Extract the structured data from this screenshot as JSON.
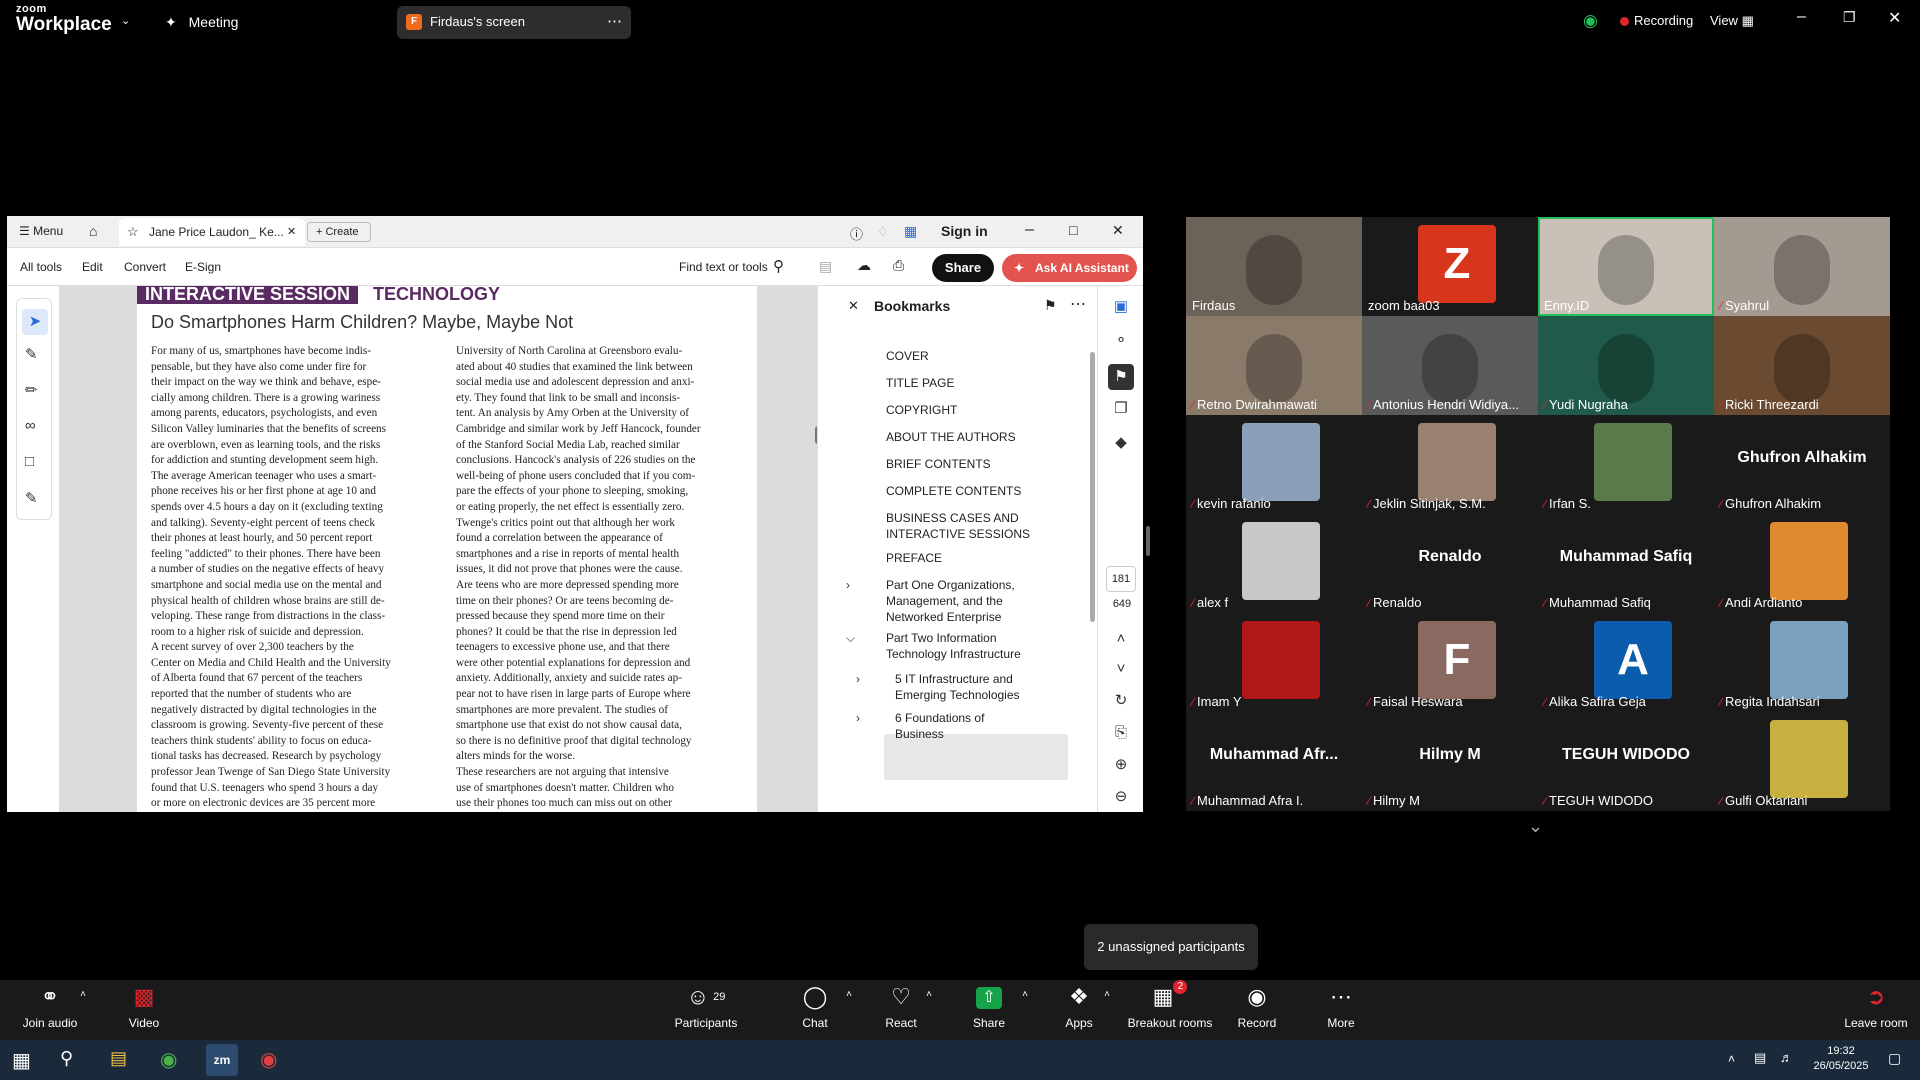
{
  "zoom": {
    "brand_small": "zoom",
    "brand_big": "Workplace",
    "meeting_label": "Meeting",
    "share_pill_label": "Firdaus's screen",
    "share_pill_initial": "F",
    "recording_label": "Recording",
    "view_label": "View"
  },
  "pdf": {
    "menu_label": "Menu",
    "tab_label": "Jane Price Laudon_ Ke...",
    "create_label": "Create",
    "sign_in_label": "Sign in",
    "tools": [
      "All tools",
      "Edit",
      "Convert",
      "E-Sign"
    ],
    "find_label": "Find text or tools",
    "share_label": "Share",
    "ai_label": "Ask AI Assistant",
    "session_label": "INTERACTIVE SESSION",
    "session_topic": "TECHNOLOGY",
    "article_title": "Do Smartphones Harm Children? Maybe, Maybe Not",
    "col1": [
      "For many of us, smartphones have become indis-",
      "pensable, but they have also come under fire for",
      "their impact on the way we think and behave, espe-",
      "cially among children. There is a growing wariness",
      "among parents, educators, psychologists, and even",
      "Silicon Valley luminaries that the benefits of screens",
      "are overblown, even as learning tools, and the risks",
      "for addiction and stunting development seem high.",
      "   The average American teenager who uses a smart-",
      "phone receives his or her first phone at age 10 and",
      "spends over 4.5 hours a day on it (excluding texting",
      "and talking). Seventy-eight percent of teens check",
      "their phones at least hourly, and 50 percent report",
      "feeling \"addicted\" to their phones. There have been",
      "a number of studies on the negative effects of heavy",
      "smartphone and social media use on the mental and",
      "physical health of children whose brains are still de-",
      "veloping. These range from distractions in the class-",
      "room to a higher risk of suicide and depression.",
      "   A recent survey of over 2,300 teachers by the",
      "Center on Media and Child Health and the University",
      "of Alberta found that 67 percent of the teachers",
      "reported that the number of students who are",
      "negatively distracted by digital technologies in the",
      "classroom is growing. Seventy-five percent of these",
      "teachers think students' ability to focus on educa-",
      "tional tasks has decreased. Research by psychology",
      "professor Jean Twenge of San Diego State University",
      "found that U.S. teenagers who spend 3 hours a day",
      "or more on electronic devices are 35 percent more"
    ],
    "col2": [
      "University of North Carolina at Greensboro evalu-",
      "ated about 40 studies that examined the link between",
      "social media use and adolescent depression and anxi-",
      "ety. They found that link to be small and inconsis-",
      "tent. An analysis by Amy Orben at the University of",
      "Cambridge and similar work by Jeff Hancock, founder",
      "of the Stanford Social Media Lab, reached similar",
      "conclusions. Hancock's analysis of 226 studies on the",
      "well-being of phone users concluded that if you com-",
      "pare the effects of your phone to sleeping, smoking,",
      "or eating properly, the net effect is essentially zero.",
      "   Twenge's critics point out that although her work",
      "found a correlation between the appearance of",
      "smartphones and a rise in reports of mental health",
      "issues, it did not prove that phones were the cause.",
      "Are teens who are more depressed spending more",
      "time on their phones? Or are teens becoming de-",
      "pressed because they spend more time on their",
      "phones? It could be that the rise in depression led",
      "teenagers to excessive phone use, and that there",
      "were other potential explanations for depression and",
      "anxiety. Additionally, anxiety and suicide rates ap-",
      "pear not to have risen in large parts of Europe where",
      "smartphones are more prevalent. The studies of",
      "smartphone use that exist do not show causal data,",
      "so there is no definitive proof that digital technology",
      "alters minds for the worse.",
      "   These researchers are not arguing that intensive",
      "use of smartphones doesn't matter. Children who",
      "use their phones too much can miss out on other"
    ],
    "bookmarks_title": "Bookmarks",
    "bookmarks": [
      {
        "label": "COVER",
        "expand": ""
      },
      {
        "label": "TITLE PAGE",
        "expand": ""
      },
      {
        "label": "COPYRIGHT",
        "expand": ""
      },
      {
        "label": "ABOUT THE AUTHORS",
        "expand": ""
      },
      {
        "label": "BRIEF CONTENTS",
        "expand": ""
      },
      {
        "label": "COMPLETE CONTENTS",
        "expand": ""
      },
      {
        "label": "BUSINESS CASES AND INTERACTIVE SESSIONS",
        "expand": ""
      },
      {
        "label": "PREFACE",
        "expand": ""
      },
      {
        "label": "Part One Organizations, Management, and the Networked Enterprise",
        "expand": ">"
      },
      {
        "label": "Part Two Information Technology Infrastructure",
        "expand": "v"
      },
      {
        "label": "5 IT Infrastructure and Emerging Technologies",
        "expand": ">"
      },
      {
        "label": "6 Foundations of Business",
        "expand": ">"
      }
    ],
    "page_current": "181",
    "page_total": "649"
  },
  "participants": [
    {
      "name": "Firdaus",
      "muted": false,
      "kind": "video",
      "color": "#6b6258"
    },
    {
      "name": "zoom baa03",
      "muted": false,
      "kind": "letter",
      "letter": "Z",
      "color": "#d8351d"
    },
    {
      "name": "Enny.ID",
      "muted": false,
      "kind": "video",
      "color": "#c9c1b8",
      "active": true
    },
    {
      "name": "Syahrul",
      "muted": true,
      "kind": "video",
      "color": "#a39a92"
    },
    {
      "name": "Retno Dwirahmawati",
      "muted": true,
      "kind": "video",
      "color": "#8a7a6a"
    },
    {
      "name": "Antonius Hendri Widiya...",
      "muted": true,
      "kind": "video",
      "color": "#5a5a5a"
    },
    {
      "name": "Yudi Nugraha",
      "muted": true,
      "kind": "video",
      "color": "#1f5a4a"
    },
    {
      "name": "Ricki Threezardi",
      "muted": true,
      "kind": "video",
      "color": "#6a4a30"
    },
    {
      "name": "kevin rafanio",
      "muted": true,
      "kind": "photo",
      "color": "#8aa0b8"
    },
    {
      "name": "Jeklin Sitinjak, S.M.",
      "muted": true,
      "kind": "photo",
      "color": "#9a8070"
    },
    {
      "name": "Irfan S.",
      "muted": true,
      "kind": "photo",
      "color": "#5a7a4a"
    },
    {
      "name": "Ghufron Alhakim",
      "muted": true,
      "kind": "name",
      "display": "Ghufron Alhakim"
    },
    {
      "name": "alex  f",
      "muted": true,
      "kind": "photo",
      "color": "#c8c8c8"
    },
    {
      "name": "Renaldo",
      "muted": true,
      "kind": "name",
      "display": "Renaldo"
    },
    {
      "name": "Muhammad Safiq",
      "muted": true,
      "kind": "name",
      "display": "Muhammad Safiq"
    },
    {
      "name": "Andi Ardianto",
      "muted": true,
      "kind": "photo",
      "color": "#e08a30"
    },
    {
      "name": "Imam Y",
      "muted": true,
      "kind": "photo",
      "color": "#b01818"
    },
    {
      "name": "Faisal Heswara",
      "muted": true,
      "kind": "letter",
      "letter": "F",
      "color": "#8a6a60"
    },
    {
      "name": "Alika Safira Geja",
      "muted": true,
      "kind": "letter",
      "letter": "A",
      "color": "#0b5cad"
    },
    {
      "name": "Regita Indahsari",
      "muted": true,
      "kind": "photo",
      "color": "#7aa0c0"
    },
    {
      "name": "Muhammad Afra I.",
      "muted": true,
      "kind": "name",
      "display": "Muhammad Afr..."
    },
    {
      "name": "Hilmy M",
      "muted": true,
      "kind": "name",
      "display": "Hilmy M"
    },
    {
      "name": "TEGUH WIDODO",
      "muted": true,
      "kind": "name",
      "display": "TEGUH WIDODO"
    },
    {
      "name": "Gulfi Oktariani",
      "muted": true,
      "kind": "photo",
      "color": "#c8b040"
    }
  ],
  "tooltip": "2 unassigned participants",
  "bottombar": {
    "join_audio": "Join audio",
    "video": "Video",
    "participants": "Participants",
    "participants_count": "29",
    "chat": "Chat",
    "react": "React",
    "share": "Share",
    "apps": "Apps",
    "breakout": "Breakout rooms",
    "breakout_badge": "2",
    "record": "Record",
    "more": "More",
    "leave": "Leave room"
  },
  "taskbar": {
    "time": "19:32",
    "date": "26/05/2025"
  }
}
